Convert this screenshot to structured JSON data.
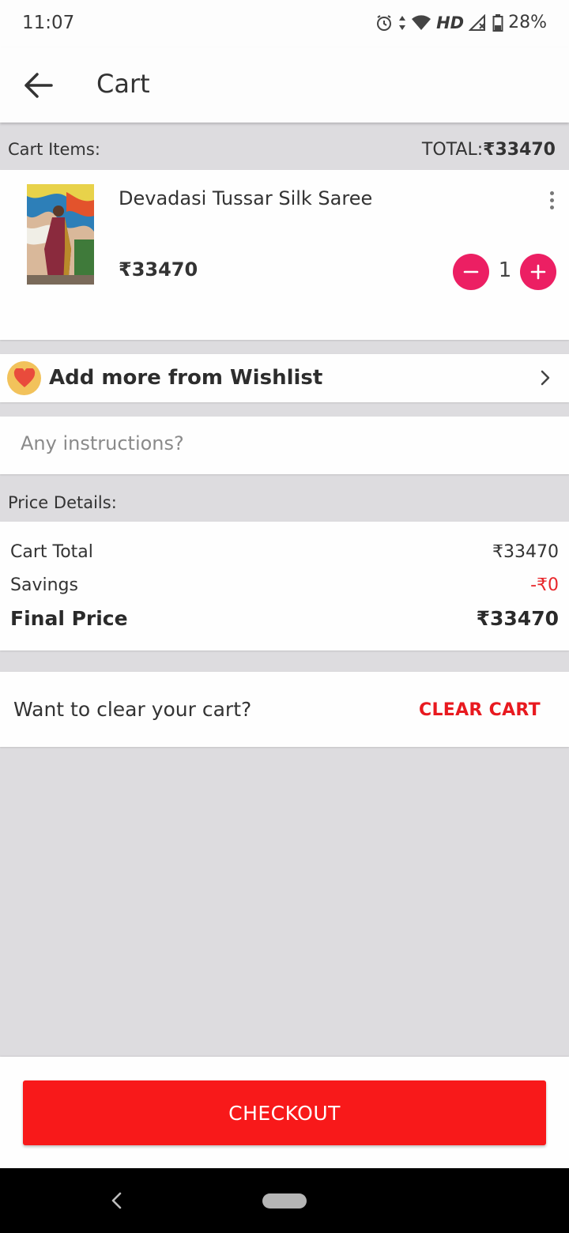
{
  "status_bar": {
    "time": "11:07",
    "network": "HD",
    "battery": "28%"
  },
  "app_bar": {
    "title": "Cart",
    "back_icon": "arrow-left-icon"
  },
  "cart_header": {
    "label": "Cart Items:",
    "total_prefix": "TOTAL:",
    "total_value": "₹33470"
  },
  "cart_items": [
    {
      "name": "Devadasi Tussar Silk Saree",
      "price": "₹33470",
      "quantity": "1"
    }
  ],
  "wishlist": {
    "label": "Add more from Wishlist",
    "icon": "heart-icon"
  },
  "instructions": {
    "placeholder": "Any instructions?",
    "value": ""
  },
  "price_details": {
    "header": "Price Details:",
    "cart_total_label": "Cart Total",
    "cart_total_value": "₹33470",
    "savings_label": "Savings",
    "savings_value": "-₹0",
    "final_label": "Final Price",
    "final_value": "₹33470"
  },
  "clear_cart": {
    "prompt": "Want to clear your cart?",
    "button": "CLEAR CART"
  },
  "checkout": {
    "label": "CHECKOUT"
  },
  "colors": {
    "accent_pink": "#ec1f63",
    "checkout_red": "#f8191a",
    "clear_red": "#e8191f",
    "savings_red": "#e8262a"
  }
}
